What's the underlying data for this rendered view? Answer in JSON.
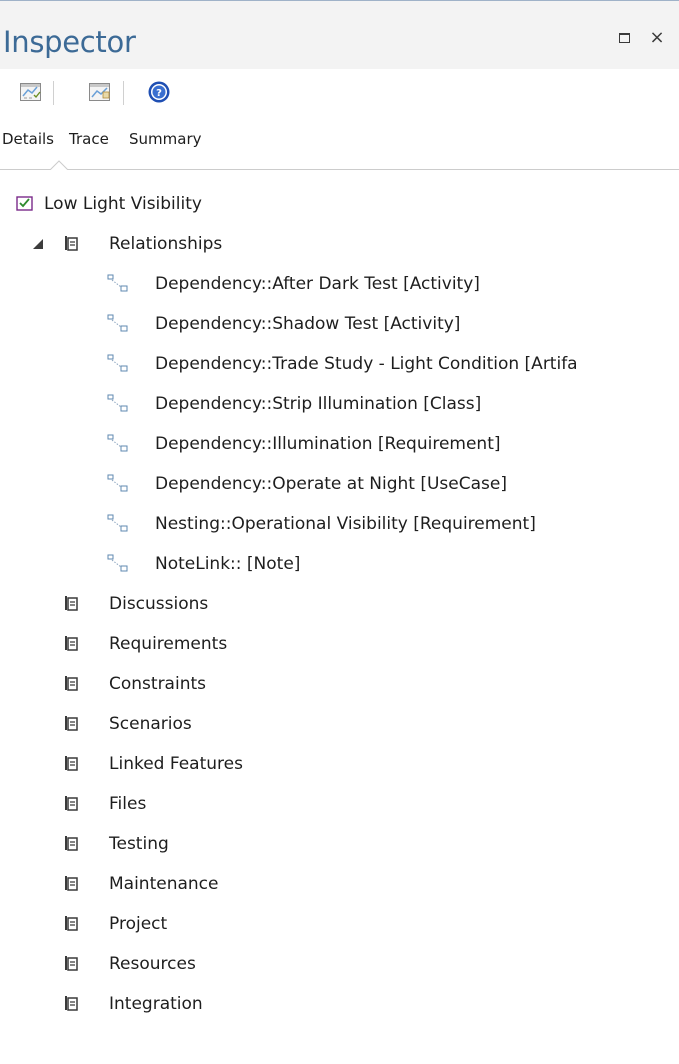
{
  "window": {
    "title": "Inspector",
    "restore_icon": "restore-icon",
    "close_glyph": "×"
  },
  "toolbar": {
    "buttons": [
      {
        "icon": "element-properties-icon"
      },
      {
        "icon": "diagram-properties-icon"
      },
      {
        "icon": "help-icon"
      }
    ]
  },
  "tabs": [
    {
      "label": "Details",
      "selected": true
    },
    {
      "label": "Trace",
      "selected": false
    },
    {
      "label": "Summary",
      "selected": false
    }
  ],
  "tree": {
    "root": {
      "label": "Low Light Visibility",
      "icon": "requirement-checkbox-icon"
    },
    "relationships": {
      "label": "Relationships",
      "expanded": true,
      "items": [
        "Dependency::After Dark Test [Activity]",
        "Dependency::Shadow Test [Activity]",
        "Dependency::Trade Study - Light Condition [Artifa",
        "Dependency::Strip Illumination [Class]",
        "Dependency::Illumination [Requirement]",
        "Dependency::Operate at Night [UseCase]",
        "Nesting::Operational Visibility [Requirement]",
        "NoteLink:: [Note]"
      ]
    },
    "sections": [
      "Discussions",
      "Requirements",
      "Constraints",
      "Scenarios",
      "Linked Features",
      "Files",
      "Testing",
      "Maintenance",
      "Project",
      "Resources",
      "Integration"
    ]
  },
  "colors": {
    "title": "#3c6a96",
    "header_bg": "#f3f3f3",
    "help_icon": "#1f4fb3",
    "checkbox_border": "#7a2a8a",
    "checkmark": "#2e8b2e"
  }
}
